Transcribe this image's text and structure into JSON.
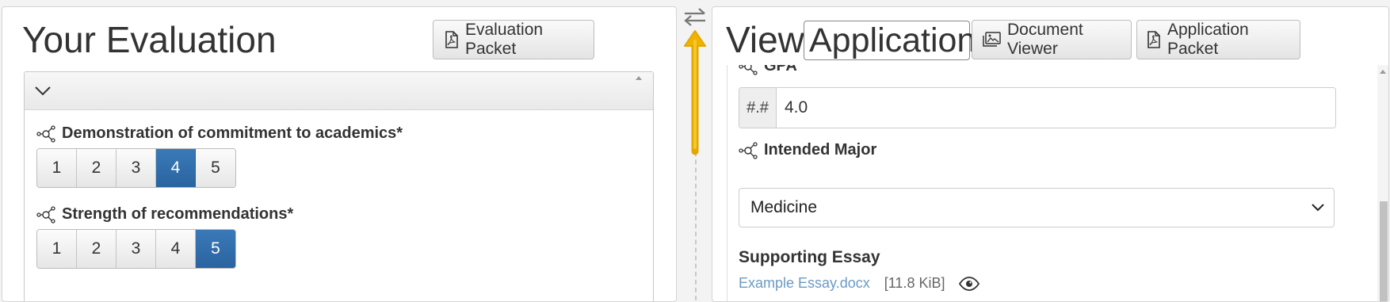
{
  "left": {
    "title": "Your Evaluation",
    "packet_button": "Evaluation Packet",
    "questions": [
      {
        "label": "Demonstration of commitment to academics*",
        "options": [
          "1",
          "2",
          "3",
          "4",
          "5"
        ],
        "selected": "4"
      },
      {
        "label": "Strength of recommendations*",
        "options": [
          "1",
          "2",
          "3",
          "4",
          "5"
        ],
        "selected": "5"
      }
    ]
  },
  "right": {
    "title": "View",
    "view_select": "Application",
    "document_viewer_button": "Document Viewer",
    "application_packet_button": "Application Packet",
    "gpa": {
      "label": "GPA",
      "addon": "#.#",
      "value": "4.0"
    },
    "major": {
      "label": "Intended Major",
      "value": "Medicine"
    },
    "essay": {
      "title": "Supporting Essay",
      "file": "Example Essay.docx",
      "size": "[11.8 KiB]"
    }
  },
  "colors": {
    "accent": "#2a64a0",
    "link": "#6b9ac4",
    "drag_arrow": "#f0b400"
  },
  "icons": [
    "pdf-icon",
    "image-icon",
    "chevron-down-icon",
    "network-icon",
    "swap-icon",
    "eye-icon",
    "arrow-up-icon"
  ]
}
